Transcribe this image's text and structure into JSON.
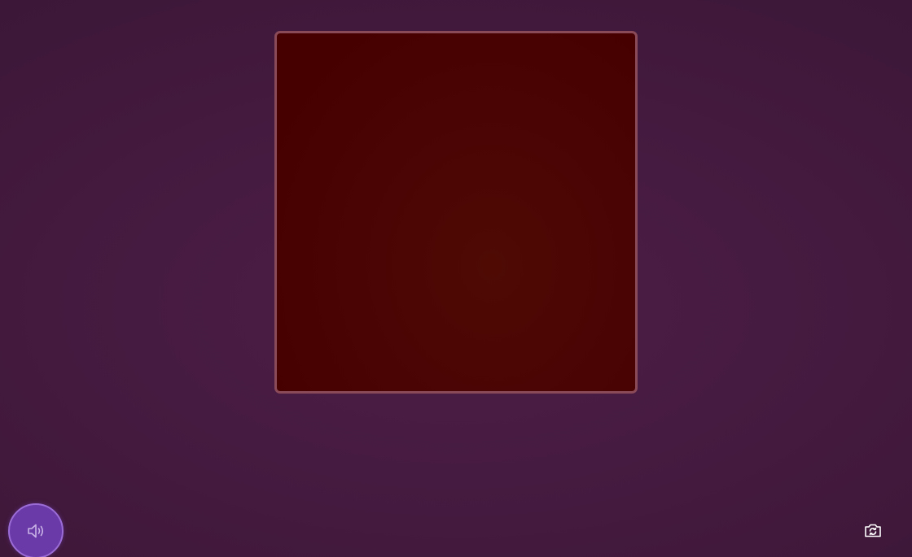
{
  "camera_view": {
    "border_color": "#8a4a58",
    "fill_color": "#4a0404"
  },
  "controls": {
    "sound_button": {
      "icon": "speaker-volume-icon",
      "accent_color": "#6a3aa8"
    },
    "switch_camera_button": {
      "icon": "switch-camera-icon",
      "color": "#ffffff"
    }
  },
  "background_color": "#461b41"
}
